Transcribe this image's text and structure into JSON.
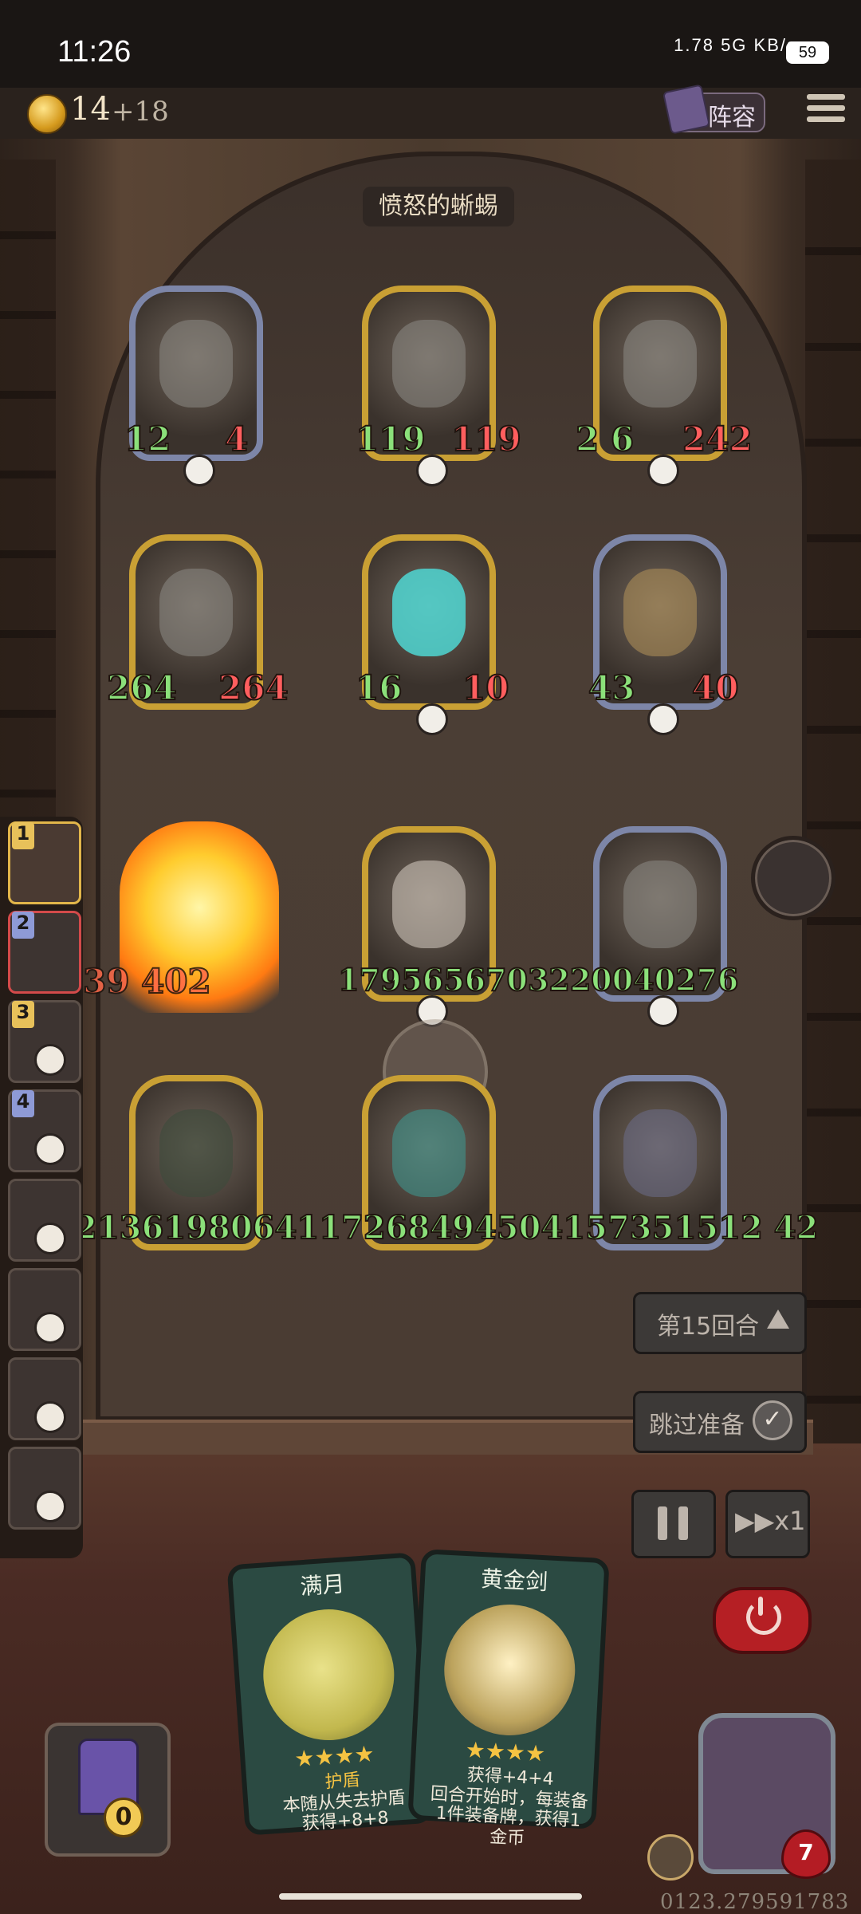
{
  "status": {
    "time": "11:26",
    "network": "1.78 5G KB/s",
    "battery": "59"
  },
  "topbar": {
    "gold": "14",
    "gold_plus": "+18",
    "lineup_label": "阵容"
  },
  "enemy": {
    "name": "愤怒的蜥蜴"
  },
  "board": {
    "cards": [
      {
        "atk": "12",
        "hp": "4"
      },
      {
        "atk": "119",
        "hp": "119"
      },
      {
        "atk": "2 6",
        "hp": "242"
      },
      {
        "atk": "264",
        "hp": "264"
      },
      {
        "atk": "16",
        "hp": "10"
      },
      {
        "atk": "43",
        "hp": "40"
      }
    ],
    "strip_row3_left": "39 402",
    "strip_row3": "1795656703220040276",
    "strip_row4": "2136198064117268494504157351512 42"
  },
  "team": [
    {
      "num": "1"
    },
    {
      "num": "2"
    },
    {
      "num": "3"
    },
    {
      "num": "4"
    }
  ],
  "controls": {
    "round_label": "第15回合",
    "skip_label": "跳过准备",
    "speed_label": "x1"
  },
  "hand": [
    {
      "title": "满月",
      "keyword": "护盾",
      "desc": "本随从失去护盾",
      "desc2": "获得+8+8",
      "stars": 4
    },
    {
      "title": "黄金剑",
      "keyword": "获得+4+4",
      "desc": "回合开始时，每装备",
      "desc2": "1件装备牌，获得1金币",
      "stars": 4
    }
  ],
  "deck": {
    "count": "0"
  },
  "hero": {
    "hp": "7"
  },
  "footer": {
    "number": "0123.279591783"
  },
  "colors": {
    "gold_frame": "#c9a034",
    "silver_frame": "#7d86a8",
    "attack_green": "#8be07a",
    "hp_red": "#ff5e5e",
    "power_red": "#b51f24"
  }
}
